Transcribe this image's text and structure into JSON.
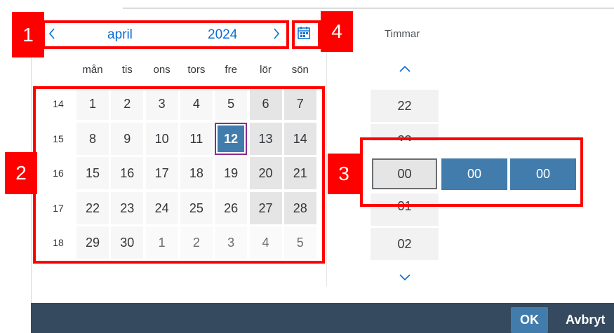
{
  "header": {
    "month": "april",
    "year": "2024",
    "prev_icon": "chevron-left-icon",
    "next_icon": "chevron-right-icon",
    "picker_icon": "calendar-icon"
  },
  "weekdays": [
    "mån",
    "tis",
    "ons",
    "tors",
    "fre",
    "lör",
    "sön"
  ],
  "weeks": [
    {
      "number": "14",
      "days": [
        "1",
        "2",
        "3",
        "4",
        "5",
        "6",
        "7"
      ]
    },
    {
      "number": "15",
      "days": [
        "8",
        "9",
        "10",
        "11",
        "12",
        "13",
        "14"
      ]
    },
    {
      "number": "16",
      "days": [
        "15",
        "16",
        "17",
        "18",
        "19",
        "20",
        "21"
      ]
    },
    {
      "number": "17",
      "days": [
        "22",
        "23",
        "24",
        "25",
        "26",
        "27",
        "28"
      ]
    },
    {
      "number": "18",
      "days": [
        "29",
        "30",
        "1",
        "2",
        "3",
        "4",
        "5"
      ]
    }
  ],
  "selected_day": "12",
  "time": {
    "hours_label": "Timmar",
    "hours": [
      "22",
      "23",
      "00",
      "01",
      "02"
    ],
    "selected_hour": "00",
    "minutes": "00",
    "seconds": "00",
    "up_icon": "chevron-up-icon",
    "down_icon": "chevron-down-icon"
  },
  "footer": {
    "ok_label": "OK",
    "cancel_label": "Avbryt"
  },
  "annotations": [
    "1",
    "2",
    "3",
    "4"
  ],
  "colors": {
    "accent": "#427cac",
    "link": "#0a6ed1",
    "selection_border": "#8e2a8e",
    "footer": "#354a5f",
    "annotation": "#ff0000"
  }
}
